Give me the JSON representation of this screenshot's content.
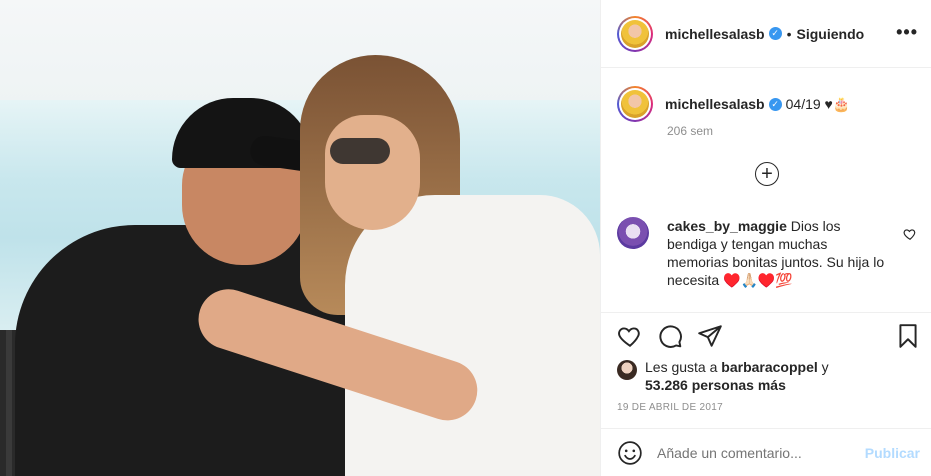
{
  "post": {
    "author": "michellesalasb",
    "follow_status": "Siguiendo",
    "more_icon": "•••",
    "caption_text": "04/19 ♥🎂",
    "caption_age": "206 sem",
    "load_more_symbol": "+",
    "comment": {
      "user": "cakes_by_maggie",
      "text": "Dios los bendiga y tengan muchas memorias bonitas juntos. Su hija lo necesita ♥️🙏🏻♥️💯"
    },
    "likes": {
      "prefix": "Les gusta a ",
      "user": "barbaracoppel",
      "suffix": " y",
      "others": "53.286 personas más"
    },
    "date": "19 DE ABRIL DE 2017",
    "comment_placeholder": "Añade un comentario...",
    "publish_label": "Publicar"
  },
  "icons": {
    "header": [
      "avatar",
      "verified-icon",
      "more-options-icon"
    ],
    "actions": [
      "heart-icon",
      "comment-icon",
      "share-icon",
      "bookmark-icon"
    ],
    "comment_bar": [
      "emoji-icon"
    ]
  },
  "colors": {
    "verified": "#3897f0",
    "publish_disabled": "#b3dbff",
    "secondary_text": "#8e8e8e",
    "border": "#efefef"
  }
}
